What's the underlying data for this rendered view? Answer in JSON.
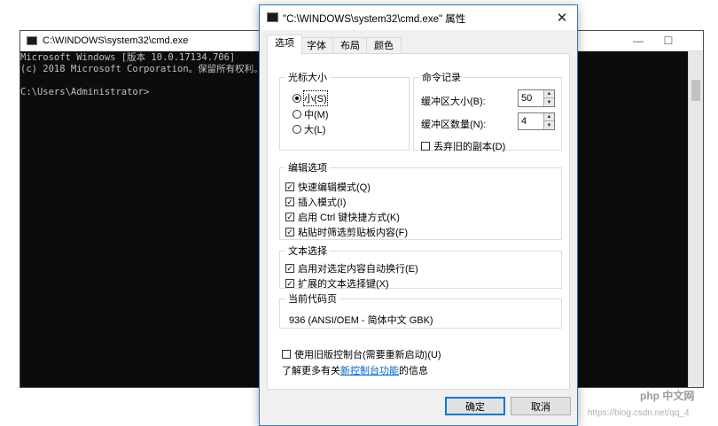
{
  "console": {
    "title": "C:\\WINDOWS\\system32\\cmd.exe",
    "lines": [
      "Microsoft Windows [版本 10.0.17134.706]",
      "(c) 2018 Microsoft Corporation。保留所有权利。",
      "",
      "C:\\Users\\Administrator>"
    ]
  },
  "dialog": {
    "title": "\"C:\\WINDOWS\\system32\\cmd.exe\" 属性",
    "tabs": [
      {
        "label": "选项",
        "active": true
      },
      {
        "label": "字体",
        "active": false
      },
      {
        "label": "布局",
        "active": false
      },
      {
        "label": "颜色",
        "active": false
      }
    ],
    "cursor_size": {
      "legend": "光标大小",
      "options": [
        {
          "label": "小(S)",
          "selected": true
        },
        {
          "label": "中(M)",
          "selected": false
        },
        {
          "label": "大(L)",
          "selected": false
        }
      ]
    },
    "command_history": {
      "legend": "命令记录",
      "buffer_size_label": "缓冲区大小(B):",
      "buffer_size_value": "50",
      "buffer_count_label": "缓冲区数量(N):",
      "buffer_count_value": "4",
      "discard_label": "丢弃旧的副本(D)",
      "discard_checked": false
    },
    "edit_options": {
      "legend": "编辑选项",
      "items": [
        {
          "label": "快速编辑模式(Q)",
          "checked": true
        },
        {
          "label": "插入模式(I)",
          "checked": true
        },
        {
          "label": "启用 Ctrl 键快捷方式(K)",
          "checked": true
        },
        {
          "label": "粘贴时筛选剪贴板内容(F)",
          "checked": true
        }
      ]
    },
    "text_selection": {
      "legend": "文本选择",
      "items": [
        {
          "label": "启用对选定内容自动换行(E)",
          "checked": true
        },
        {
          "label": "扩展的文本选择键(X)",
          "checked": true
        }
      ]
    },
    "codepage": {
      "legend": "当前代码页",
      "value": "936   (ANSI/OEM - 简体中文 GBK)"
    },
    "legacy_console_label": "使用旧版控制台(需要重新启动)(U)",
    "legacy_console_checked": false,
    "learn_more_prefix": "了解更多有关",
    "learn_more_link": "新控制台功能",
    "learn_more_suffix": "的信息",
    "ok_label": "确定",
    "cancel_label": "取消"
  },
  "watermark": {
    "text": "php 中文网",
    "url_text": "https://blog.csdn.net/qq_4"
  },
  "icons": {
    "close": "✕",
    "minimize": "—",
    "maximize": "☐",
    "check": "✓",
    "spin_up": "▲",
    "spin_down": "▼"
  }
}
